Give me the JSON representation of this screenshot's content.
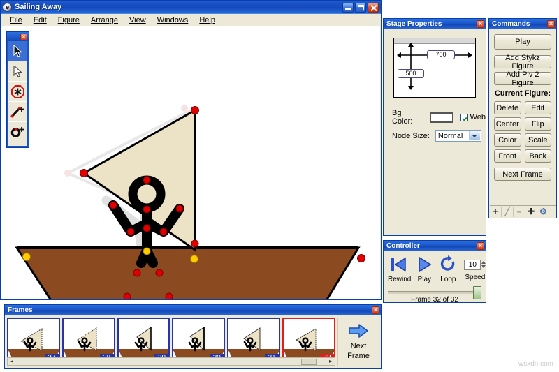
{
  "app": {
    "title": "Sailing Away",
    "icon": "app-globe-icon",
    "window_buttons": {
      "minimize": "minimize",
      "maximize": "maximize",
      "close": "close"
    }
  },
  "menubar": {
    "items": [
      {
        "label": "File"
      },
      {
        "label": "Edit"
      },
      {
        "label": "Figure"
      },
      {
        "label": "Arrange"
      },
      {
        "label": "View"
      },
      {
        "label": "Windows"
      },
      {
        "label": "Help"
      }
    ]
  },
  "tool_palette": {
    "close_label": "×",
    "tools": [
      {
        "name": "select-arrow-tool",
        "selected": true
      },
      {
        "name": "move-arrow-tool",
        "selected": false
      },
      {
        "name": "node-tool",
        "selected": false
      },
      {
        "name": "add-line-tool",
        "selected": false
      },
      {
        "name": "add-circle-tool",
        "selected": false
      }
    ]
  },
  "stage_properties": {
    "title": "Stage Properties",
    "close_label": "×",
    "width_value": "700",
    "height_value": "500",
    "bg_color_label": "Bg Color:",
    "bg_color_value": "#ffffff",
    "web_label": "Web",
    "web_checked": true,
    "node_size_label": "Node Size:",
    "node_size_value": "Normal",
    "node_size_options": [
      "Normal"
    ]
  },
  "commands": {
    "title": "Commands",
    "close_label": "×",
    "play": "Play",
    "add_stykz_figure": "Add Stykz Figure",
    "add_piv2_figure": "Add Piv 2 Figure",
    "current_figure_label": "Current Figure:",
    "grid": [
      [
        "Delete",
        "Edit"
      ],
      [
        "Center",
        "Flip"
      ],
      [
        "Color",
        "Scale"
      ],
      [
        "Front",
        "Back"
      ]
    ],
    "next_frame": "Next Frame",
    "mini_toolbar": [
      {
        "name": "add-icon",
        "glyph": "+"
      },
      {
        "name": "edit-pencil-icon",
        "glyph": "╱"
      },
      {
        "name": "remove-icon",
        "glyph": "–"
      },
      {
        "name": "move-icon",
        "glyph": "✛"
      },
      {
        "name": "settings-gear-icon",
        "glyph": "⚙"
      }
    ]
  },
  "controller": {
    "title": "Controller",
    "close_label": "×",
    "rewind_label": "Rewind",
    "play_label": "Play",
    "loop_label": "Loop",
    "speed_label": "Speed",
    "speed_value": "10",
    "frame_status": "Frame 32 of 32",
    "slider_position_percent": 100
  },
  "frames": {
    "title": "Frames",
    "close_label": "×",
    "items": [
      {
        "number": "27",
        "selected": false
      },
      {
        "number": "28",
        "selected": false
      },
      {
        "number": "29",
        "selected": false
      },
      {
        "number": "30",
        "selected": false
      },
      {
        "number": "31",
        "selected": false
      },
      {
        "number": "32",
        "selected": true
      }
    ],
    "next_frame_line1": "Next",
    "next_frame_line2": "Frame",
    "scroll_left": "◂",
    "scroll_right": "▸"
  },
  "canvas": {
    "sail_fill": "#ece2c6",
    "hull_fill": "#8c4a20",
    "node_color": "#e00000",
    "anchor_color": "#ffcc00",
    "onion_skin_color": "#c9c9c9"
  },
  "watermark": {
    "text": "wsxdn.com"
  }
}
